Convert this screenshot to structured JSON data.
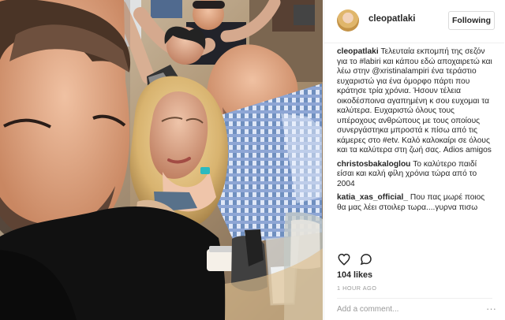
{
  "post": {
    "username": "cleopatlaki",
    "follow_label": "Following",
    "caption_user": "cleopatlaki",
    "caption_text": "Τελευταία εκπομπή της σεζόν για το #labiri και κάπου εδώ αποχαιρετώ και λέω στην @xristinalampiri ένα τεράστιο ευχαριστώ για ένα όμορφο πάρτι που κράτησε τρία χρόνια. Ήσουν τέλεια οικοδέσποινα αγαπημένη κ σου ευχομαι τα καλύτερα. Ευχαριστώ όλους τους υπέροχους ανθρώπους με τους οποίους συνεργάστηκα μπροστά κ πίσω από τις κάμερες στο #etv. Καλό καλοκαίρι σε όλους και τα καλύτερα στη ζωή σας. Adios amigos",
    "comments": [
      {
        "user": "christosbakaloglou",
        "text": "Το καλύτερο παιδί είσαι και καλή φίλη χρόνια τώρα από το 2004"
      },
      {
        "user": "katia_xas_official_",
        "text": "Που πας μωρέ ποιος θα μας λέει στοιλερ τωρα....γυρνα πισω"
      }
    ],
    "likes": "104 likes",
    "time": "1 HOUR AGO",
    "add_comment_placeholder": "Add a comment...",
    "more_symbol": "···"
  },
  "icons": {
    "like": "heart-icon",
    "comment": "comment-icon",
    "more": "more-options-icon"
  }
}
